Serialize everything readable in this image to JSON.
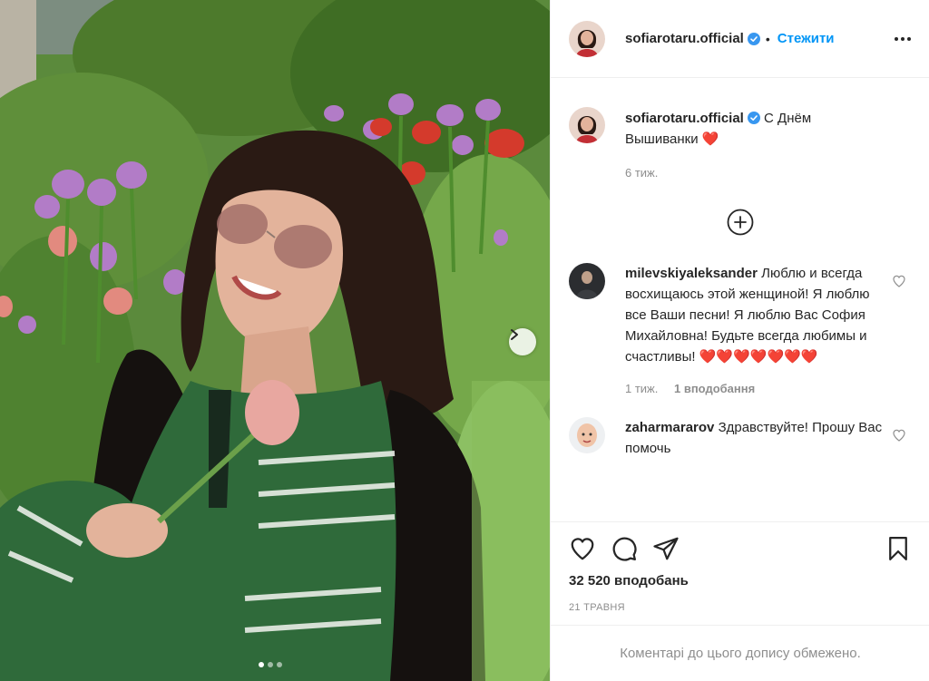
{
  "post": {
    "username": "sofiarotaru.official",
    "follow_label": "Стежити",
    "separator": "•",
    "caption_text": "С Днём Вышиванки",
    "caption_emoji": "❤️",
    "caption_time": "6 тиж.",
    "likes_text": "32 520 вподобань",
    "date_text": "21 ТРАВНЯ",
    "comments_closed_text": "Коментарі до цього допису обмежено."
  },
  "comments": [
    {
      "username": "milevskiyaleksander",
      "text": "Люблю и всегда восхищаюсь этой женщиной! Я люблю все Ваши песни! Я люблю Вас София Михайловна! Будьте всегда любимы и счастливы!",
      "emoji": "❤️❤️❤️❤️❤️❤️❤️",
      "time": "1 тиж.",
      "likes": "1 вподобання"
    },
    {
      "username": "zaharmararov",
      "text": "Здравствуйте! Прошу Вас помочь"
    }
  ],
  "icons": {
    "verified": "verified-badge-icon",
    "more": "more-options-icon",
    "load_more": "plus-circle-icon",
    "like": "heart-outline-icon",
    "comment": "comment-bubble-icon",
    "share": "paper-plane-icon",
    "save": "bookmark-icon",
    "next": "chevron-right-icon"
  },
  "carousel": {
    "total": 3,
    "active": 0
  },
  "colors": {
    "accent": "#0095f6",
    "verified": "#3897f0",
    "heart": "#ed4956",
    "muted": "#8e8e8e"
  }
}
